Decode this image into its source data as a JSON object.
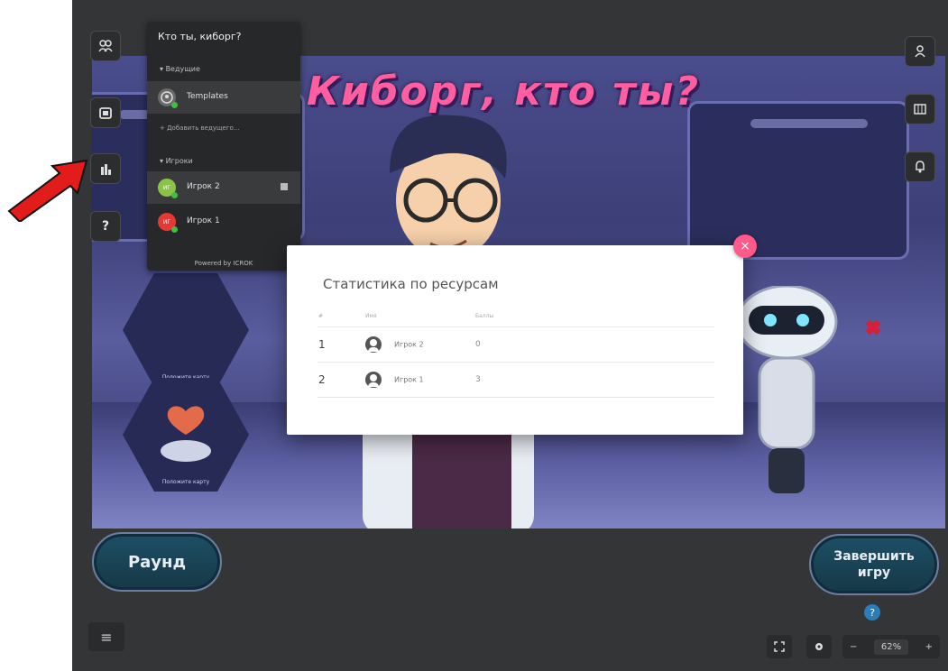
{
  "banner": {
    "title": "Киборг, кто ты?"
  },
  "panel": {
    "title": "Кто ты, киборг?",
    "hosts_section": "Ведущие",
    "hosts": [
      {
        "name": "Templates",
        "color": "#6a6a6a"
      }
    ],
    "add_host": "+ Добавить ведущего...",
    "players_section": "Игроки",
    "players": [
      {
        "name": "Игрок 2",
        "initials": "ИГ",
        "color": "#8bc34a"
      },
      {
        "name": "Игрок 1",
        "initials": "ИГ",
        "color": "#e53935"
      }
    ],
    "powered": "Powered by ICROK"
  },
  "modal": {
    "title": "Статистика по ресурсам",
    "columns": [
      "#",
      "Имя",
      "Баллы"
    ],
    "rows": [
      {
        "rank": "1",
        "name": "Игрок 2",
        "value": "0"
      },
      {
        "rank": "2",
        "name": "Игрок 1",
        "value": "3"
      }
    ],
    "close": "×"
  },
  "hexes": [
    {
      "label": "Положите карту"
    },
    {
      "label": "Положите карту"
    }
  ],
  "buttons": {
    "round": "Раунд",
    "finish_line1": "Завершить",
    "finish_line2": "игру",
    "help": "?",
    "menu": "≡",
    "zoom_minus": "−",
    "zoom_value": "62%",
    "zoom_plus": "+"
  },
  "colors": {
    "accent": "#ff5a8a",
    "panel_bg": "#272829",
    "app_bg": "#343537"
  }
}
